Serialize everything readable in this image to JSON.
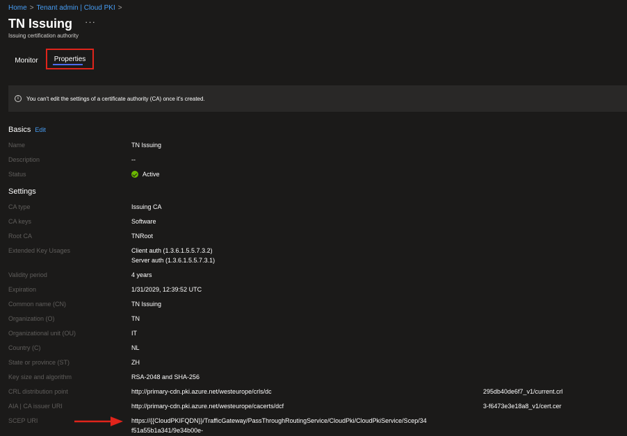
{
  "breadcrumb": {
    "items": [
      "Home",
      "Tenant admin | Cloud PKI"
    ],
    "separator": ">"
  },
  "header": {
    "title": "TN Issuing",
    "more": "···",
    "subtitle": "Issuing certification authority"
  },
  "tabs": [
    {
      "label": "Monitor",
      "selected": false
    },
    {
      "label": "Properties",
      "selected": true
    }
  ],
  "banner": {
    "icon": "info-icon",
    "text": "You can't edit the settings of a certificate authority (CA) once it's created."
  },
  "basics": {
    "title": "Basics",
    "edit_label": "Edit",
    "rows": [
      {
        "label": "Name",
        "value": "TN Issuing"
      },
      {
        "label": "Description",
        "value": "--"
      },
      {
        "label": "Status",
        "value": "Active"
      }
    ]
  },
  "settings": {
    "title": "Settings",
    "rows": [
      {
        "label": "CA type",
        "value": "Issuing CA"
      },
      {
        "label": "CA keys",
        "value": "Software"
      },
      {
        "label": "Root CA",
        "value": "TNRoot"
      },
      {
        "label": "Extended Key Usages",
        "value": "Client auth (1.3.6.1.5.5.7.3.2)",
        "value2": "Server auth (1.3.6.1.5.5.7.3.1)"
      },
      {
        "label": "Validity period",
        "value": "4 years"
      },
      {
        "label": "Expiration",
        "value": "1/31/2029, 12:39:52 UTC"
      },
      {
        "label": "Common name (CN)",
        "value": "TN Issuing"
      },
      {
        "label": "Organization (O)",
        "value": "TN"
      },
      {
        "label": "Organizational unit (OU)",
        "value": "IT"
      },
      {
        "label": "Country (C)",
        "value": "NL"
      },
      {
        "label": "State or province (ST)",
        "value": "ZH"
      },
      {
        "label": "Key size and algorithm",
        "value": "RSA-2048 and SHA-256"
      },
      {
        "label": "CRL distribution point",
        "value": "http://primary-cdn.pki.azure.net/westeurope/crls/dc",
        "tail": "295db40de6f7_v1/current.crl"
      },
      {
        "label": "AIA | CA issuer URI",
        "value": "http://primary-cdn.pki.azure.net/westeurope/cacerts/dcf",
        "tail": "3-f6473e3e18a8_v1/cert.cer"
      },
      {
        "label": "SCEP URI",
        "value": "https://{{CloudPKIFQDN}}/TrafficGateway/PassThroughRoutingService/CloudPki/CloudPkiService/Scep/34",
        "value2": "f51a55b1a341/9e34b00e-"
      }
    ]
  },
  "colors": {
    "background": "#1b1a19",
    "banner": "#292827",
    "link": "#479ef5",
    "label": "#605e5c",
    "status_active": "#6bb700",
    "highlight": "#e0241b",
    "tab_underline": "#4f6bed"
  }
}
